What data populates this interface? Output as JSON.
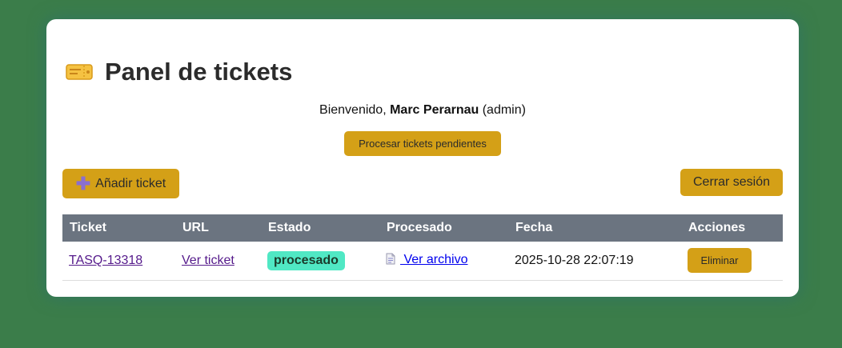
{
  "header": {
    "title": "Panel de tickets",
    "icon": "ticket-icon"
  },
  "welcome": {
    "prefix": "Bienvenido, ",
    "user_name": "Marc Perarnau",
    "role": "(admin)"
  },
  "actions": {
    "process_label": "Procesar tickets pendientes",
    "add_label": "Añadir ticket",
    "logout_label": "Cerrar sesión"
  },
  "table": {
    "columns": [
      "Ticket",
      "URL",
      "Estado",
      "Procesado",
      "Fecha",
      "Acciones"
    ],
    "rows": [
      {
        "ticket": "TASQ-13318",
        "url_label": "Ver ticket",
        "status": "procesado",
        "processed_label": " Ver archivo",
        "date": "2025-10-28 22:07:19",
        "action_label": "Eliminar"
      }
    ]
  },
  "colors": {
    "background": "#3b7d4a",
    "accent": "#d4a017",
    "table_header": "#6b7480",
    "status_badge": "#50e8c4"
  }
}
